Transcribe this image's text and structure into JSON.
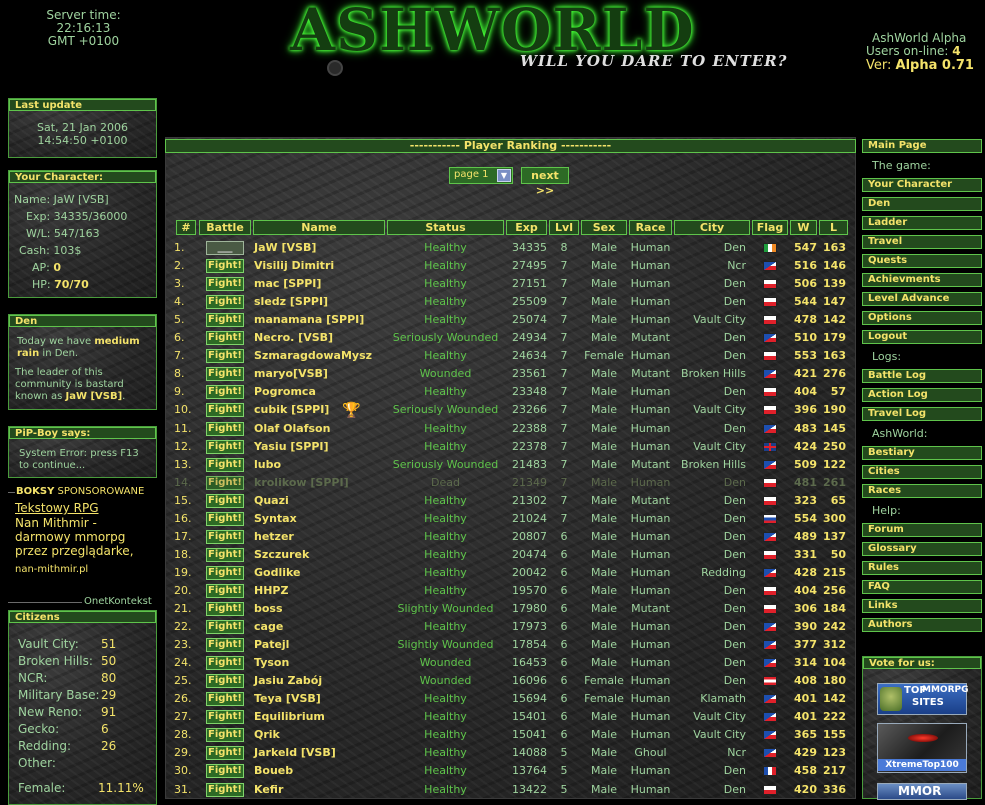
{
  "header": {
    "server_time_label": "Server time:",
    "server_time": "22:16:13",
    "timezone": "GMT +0100",
    "logo_text": "ASHWORLD",
    "tagline": "WILL YOU DARE TO ENTER?",
    "alpha_title": "AshWorld Alpha",
    "users_online_label": "Users on-line:",
    "users_online": "4",
    "version_label": "Ver:",
    "version": "Alpha 0.71"
  },
  "last_update": {
    "title": "Last update",
    "date": "Sat, 21 Jan 2006",
    "time": "14:54:50 +0100"
  },
  "character": {
    "title": "Your Character:",
    "name_label": "Name:",
    "name": "JaW [VSB]",
    "exp_label": "Exp:",
    "exp": "34335/36000",
    "wl_label": "W/L:",
    "wl": "547/163",
    "cash_label": "Cash:",
    "cash": "103$",
    "ap_label": "AP:",
    "ap": "0",
    "hp_label": "HP:",
    "hp": "70/70"
  },
  "den": {
    "title": "Den",
    "p1a": "Today we have",
    "p1b": "medium rain",
    "p1c": "in Den.",
    "p2a": "The leader of this community is bastard known as",
    "p2b": "JaW [VSB]",
    "p2c": "."
  },
  "pipboy": {
    "title": "PiP-Boy says:",
    "text": "System Error: press F13 to continue..."
  },
  "sponsor": {
    "title": "BOKSY",
    "title2": "SPONSOROWANE",
    "link": "Tekstowy RPG",
    "desc": "Nan Mithmir - darmowy mmorpg przez przeglądarke,",
    "url": "nan-mithmir.pl",
    "footer": "OnetKontekst"
  },
  "citizens": {
    "title": "Citizens",
    "items": [
      {
        "label": "Vault City:",
        "value": "51"
      },
      {
        "label": "Broken Hills:",
        "value": "50"
      },
      {
        "label": "NCR:",
        "value": "80"
      },
      {
        "label": "Military Base:",
        "value": "29"
      },
      {
        "label": "New Reno:",
        "value": "91"
      },
      {
        "label": "Gecko:",
        "value": "6"
      },
      {
        "label": "Redding:",
        "value": "26"
      },
      {
        "label": "Other:",
        "value": ""
      }
    ],
    "female_label": "Female:",
    "female_value": "11.11%"
  },
  "ranking": {
    "title": "----------- Player Ranking -----------",
    "page_select": "page 1",
    "next": "next >>",
    "headers": [
      "#",
      "Battle",
      "Name",
      "Status",
      "Exp",
      "Lvl",
      "Sex",
      "Race",
      "City",
      "Flag",
      "W",
      "L"
    ],
    "fight_label": "Fight!",
    "self_label": "___",
    "rows": [
      {
        "n": "1.",
        "name": "JaW [VSB]",
        "status": "Healthy",
        "exp": "34335",
        "lvl": "8",
        "sex": "Male",
        "race": "Human",
        "city": "Den",
        "flag": "ie",
        "w": "547",
        "l": "163",
        "self": true
      },
      {
        "n": "2.",
        "name": "Visilij Dimitri",
        "status": "Healthy",
        "exp": "27495",
        "lvl": "7",
        "sex": "Male",
        "race": "Human",
        "city": "Ncr",
        "flag": "cz",
        "w": "516",
        "l": "146"
      },
      {
        "n": "3.",
        "name": "mac [SPPI]",
        "status": "Healthy",
        "exp": "27151",
        "lvl": "7",
        "sex": "Male",
        "race": "Human",
        "city": "Den",
        "flag": "pl",
        "w": "506",
        "l": "139"
      },
      {
        "n": "4.",
        "name": "sledz [SPPI]",
        "status": "Healthy",
        "exp": "25509",
        "lvl": "7",
        "sex": "Male",
        "race": "Human",
        "city": "Den",
        "flag": "pl",
        "w": "544",
        "l": "147"
      },
      {
        "n": "5.",
        "name": "manamana [SPPI]",
        "status": "Healthy",
        "exp": "25074",
        "lvl": "7",
        "sex": "Male",
        "race": "Human",
        "city": "Vault City",
        "flag": "pl",
        "w": "478",
        "l": "142"
      },
      {
        "n": "6.",
        "name": "Necro. [VSB]",
        "status": "Seriously Wounded",
        "exp": "24934",
        "lvl": "7",
        "sex": "Male",
        "race": "Mutant",
        "city": "Den",
        "flag": "cz",
        "w": "510",
        "l": "179"
      },
      {
        "n": "7.",
        "name": "SzmaragdowaMysz",
        "status": "Healthy",
        "exp": "24634",
        "lvl": "7",
        "sex": "Female",
        "race": "Human",
        "city": "Den",
        "flag": "pl",
        "w": "553",
        "l": "163"
      },
      {
        "n": "8.",
        "name": "maryo[VSB]",
        "status": "Wounded",
        "exp": "23561",
        "lvl": "7",
        "sex": "Male",
        "race": "Mutant",
        "city": "Broken Hills",
        "flag": "cz",
        "w": "421",
        "l": "276"
      },
      {
        "n": "9.",
        "name": "Pogromca",
        "status": "Healthy",
        "exp": "23348",
        "lvl": "7",
        "sex": "Male",
        "race": "Human",
        "city": "Den",
        "flag": "pl",
        "w": "404",
        "l": "57"
      },
      {
        "n": "10.",
        "name": "cubik [SPPI]",
        "status": "Seriously Wounded",
        "exp": "23266",
        "lvl": "7",
        "sex": "Male",
        "race": "Human",
        "city": "Vault City",
        "flag": "pl",
        "w": "396",
        "l": "190",
        "trophy": true
      },
      {
        "n": "11.",
        "name": "Olaf Olafson",
        "status": "Healthy",
        "exp": "22388",
        "lvl": "7",
        "sex": "Male",
        "race": "Human",
        "city": "Den",
        "flag": "cz",
        "w": "483",
        "l": "145"
      },
      {
        "n": "12.",
        "name": "Yasiu [SPPI]",
        "status": "Healthy",
        "exp": "22378",
        "lvl": "7",
        "sex": "Male",
        "race": "Human",
        "city": "Vault City",
        "flag": "gb",
        "w": "424",
        "l": "250"
      },
      {
        "n": "13.",
        "name": "lubo",
        "status": "Seriously Wounded",
        "exp": "21483",
        "lvl": "7",
        "sex": "Male",
        "race": "Mutant",
        "city": "Broken Hills",
        "flag": "cz",
        "w": "509",
        "l": "122"
      },
      {
        "n": "14.",
        "name": "krolikow [SPPI]",
        "status": "Dead",
        "exp": "21349",
        "lvl": "7",
        "sex": "Male",
        "race": "Human",
        "city": "Den",
        "flag": "pl",
        "w": "481",
        "l": "261",
        "dead": true
      },
      {
        "n": "15.",
        "name": "Quazi",
        "status": "Healthy",
        "exp": "21302",
        "lvl": "7",
        "sex": "Male",
        "race": "Mutant",
        "city": "Den",
        "flag": "pl",
        "w": "323",
        "l": "65"
      },
      {
        "n": "16.",
        "name": "Syntax",
        "status": "Healthy",
        "exp": "21024",
        "lvl": "7",
        "sex": "Male",
        "race": "Human",
        "city": "Den",
        "flag": "sk",
        "w": "554",
        "l": "300"
      },
      {
        "n": "17.",
        "name": "hetzer",
        "status": "Healthy",
        "exp": "20807",
        "lvl": "6",
        "sex": "Male",
        "race": "Human",
        "city": "Den",
        "flag": "cz",
        "w": "489",
        "l": "137"
      },
      {
        "n": "18.",
        "name": "Szczurek",
        "status": "Healthy",
        "exp": "20474",
        "lvl": "6",
        "sex": "Male",
        "race": "Human",
        "city": "Den",
        "flag": "pl",
        "w": "331",
        "l": "50"
      },
      {
        "n": "19.",
        "name": "Godlike",
        "status": "Healthy",
        "exp": "20042",
        "lvl": "6",
        "sex": "Male",
        "race": "Human",
        "city": "Redding",
        "flag": "cz",
        "w": "428",
        "l": "215"
      },
      {
        "n": "20.",
        "name": "HHPZ",
        "status": "Healthy",
        "exp": "19570",
        "lvl": "6",
        "sex": "Male",
        "race": "Human",
        "city": "Den",
        "flag": "pl",
        "w": "404",
        "l": "256"
      },
      {
        "n": "21.",
        "name": "boss",
        "status": "Slightly Wounded",
        "exp": "17980",
        "lvl": "6",
        "sex": "Male",
        "race": "Mutant",
        "city": "Den",
        "flag": "pl",
        "w": "306",
        "l": "184"
      },
      {
        "n": "22.",
        "name": "cage",
        "status": "Healthy",
        "exp": "17973",
        "lvl": "6",
        "sex": "Male",
        "race": "Human",
        "city": "Den",
        "flag": "cz",
        "w": "390",
        "l": "242"
      },
      {
        "n": "23.",
        "name": "Patejl",
        "status": "Slightly Wounded",
        "exp": "17854",
        "lvl": "6",
        "sex": "Male",
        "race": "Human",
        "city": "Den",
        "flag": "cz",
        "w": "377",
        "l": "312"
      },
      {
        "n": "24.",
        "name": "Tyson",
        "status": "Wounded",
        "exp": "16453",
        "lvl": "6",
        "sex": "Male",
        "race": "Human",
        "city": "Den",
        "flag": "cz",
        "w": "314",
        "l": "104"
      },
      {
        "n": "25.",
        "name": "Jasiu Zabój",
        "status": "Wounded",
        "exp": "16096",
        "lvl": "6",
        "sex": "Female",
        "race": "Human",
        "city": "Den",
        "flag": "at",
        "w": "408",
        "l": "180"
      },
      {
        "n": "26.",
        "name": "Teya [VSB]",
        "status": "Healthy",
        "exp": "15694",
        "lvl": "6",
        "sex": "Female",
        "race": "Human",
        "city": "Klamath",
        "flag": "cz",
        "w": "401",
        "l": "142"
      },
      {
        "n": "27.",
        "name": "Equilibrium",
        "status": "Healthy",
        "exp": "15401",
        "lvl": "6",
        "sex": "Male",
        "race": "Human",
        "city": "Vault City",
        "flag": "cz",
        "w": "401",
        "l": "222"
      },
      {
        "n": "28.",
        "name": "Qrik",
        "status": "Healthy",
        "exp": "15041",
        "lvl": "6",
        "sex": "Male",
        "race": "Human",
        "city": "Vault City",
        "flag": "cz",
        "w": "365",
        "l": "155"
      },
      {
        "n": "29.",
        "name": "Jarkeld [VSB]",
        "status": "Healthy",
        "exp": "14088",
        "lvl": "5",
        "sex": "Male",
        "race": "Ghoul",
        "city": "Ncr",
        "flag": "cz",
        "w": "429",
        "l": "123"
      },
      {
        "n": "30.",
        "name": "Boueb",
        "status": "Healthy",
        "exp": "13764",
        "lvl": "5",
        "sex": "Male",
        "race": "Human",
        "city": "Den",
        "flag": "fr",
        "w": "458",
        "l": "217"
      },
      {
        "n": "31.",
        "name": "Kefir",
        "status": "Healthy",
        "exp": "13422",
        "lvl": "5",
        "sex": "Male",
        "race": "Human",
        "city": "Den",
        "flag": "pl",
        "w": "420",
        "l": "336"
      }
    ]
  },
  "menu": {
    "main_page": "Main Page",
    "the_game": "The game:",
    "game_items": [
      "Your Character",
      "Den",
      "Ladder",
      "Travel",
      "Quests",
      "Achievments",
      "Level Advance",
      "Options",
      "Logout"
    ],
    "logs": "Logs:",
    "log_items": [
      "Battle Log",
      "Action Log",
      "Travel Log"
    ],
    "ashworld": "AshWorld:",
    "ash_items": [
      "Bestiary",
      "Cities",
      "Races"
    ],
    "help": "Help:",
    "help_items": [
      "Forum",
      "Glossary",
      "Rules",
      "FAQ",
      "Links",
      "Authors"
    ]
  },
  "vote": {
    "title": "Vote for us:",
    "banner1a": "TOP",
    "banner1b": "MMORPG",
    "banner1c": "SITES",
    "banner2": "XtremeTop100",
    "banner3": "MMOR"
  },
  "colors": {
    "accent_green": "#5fc44b",
    "label_yellow": "#f4e36a",
    "header_bg": "#234a1d"
  }
}
